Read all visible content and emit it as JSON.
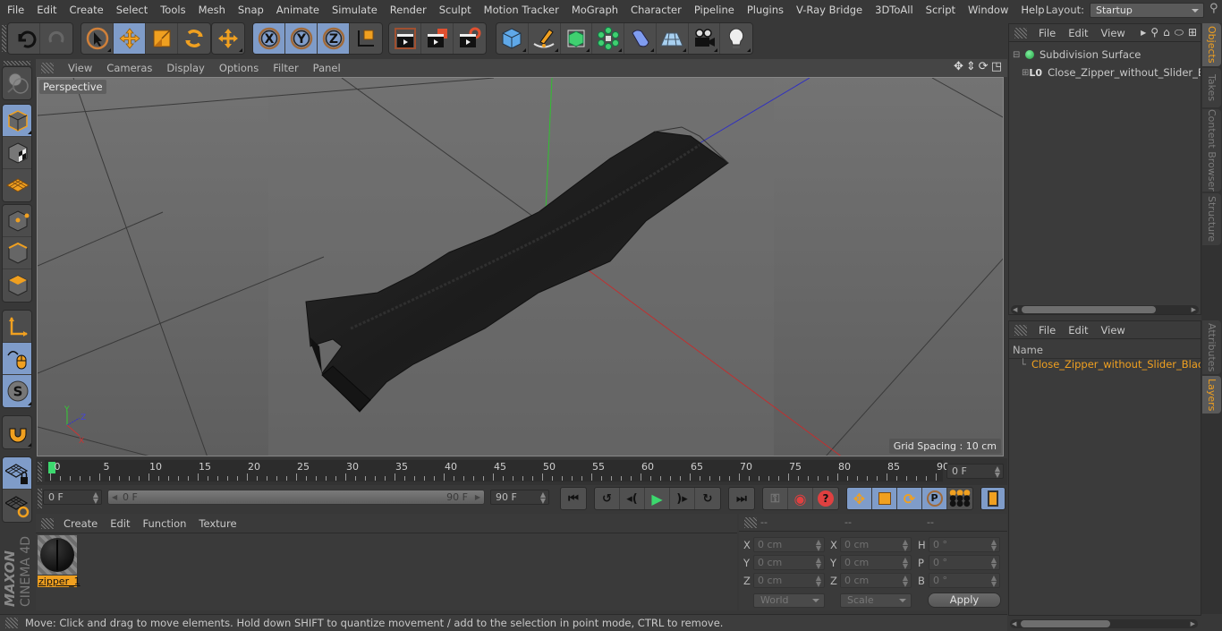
{
  "menubar": {
    "items": [
      "File",
      "Edit",
      "Create",
      "Select",
      "Tools",
      "Mesh",
      "Snap",
      "Animate",
      "Simulate",
      "Render",
      "Sculpt",
      "Motion Tracker",
      "MoGraph",
      "Character",
      "Pipeline",
      "Plugins",
      "V-Ray Bridge",
      "3DToAll",
      "Script",
      "Window",
      "Help"
    ],
    "layout_label": "Layout:",
    "layout_value": "Startup"
  },
  "toolbar": {
    "groups": [
      {
        "buttons": [
          {
            "icon": "undo-icon",
            "active": false
          },
          {
            "icon": "redo-icon",
            "active": false
          }
        ]
      },
      {
        "buttons": [
          {
            "icon": "live-selection-icon",
            "active": false
          },
          {
            "icon": "move-icon",
            "active": true
          },
          {
            "icon": "scale-icon",
            "active": false
          },
          {
            "icon": "rotate-icon",
            "active": false
          }
        ]
      },
      {
        "buttons": [
          {
            "icon": "recent-tools-icon",
            "active": false
          }
        ]
      },
      {
        "buttons": [
          {
            "icon": "x-axis-lock-icon",
            "active": true
          },
          {
            "icon": "y-axis-lock-icon",
            "active": true
          },
          {
            "icon": "z-axis-lock-icon",
            "active": true
          },
          {
            "icon": "coordinate-system-icon",
            "active": false
          }
        ]
      },
      {
        "buttons": [
          {
            "icon": "render-view-icon",
            "active": false
          },
          {
            "icon": "render-to-picture-viewer-icon",
            "active": false
          },
          {
            "icon": "render-settings-icon",
            "active": false
          }
        ]
      },
      {
        "buttons": [
          {
            "icon": "cube-primitive-icon",
            "active": false
          },
          {
            "icon": "pen-spline-icon",
            "active": false
          },
          {
            "icon": "subdivision-surface-icon",
            "active": false
          },
          {
            "icon": "cloner-icon",
            "active": false
          },
          {
            "icon": "deformer-icon",
            "active": false
          },
          {
            "icon": "floor-icon",
            "active": false
          },
          {
            "icon": "camera-icon",
            "active": false
          },
          {
            "icon": "light-icon",
            "active": false
          }
        ]
      }
    ]
  },
  "left_tools": [
    {
      "icon": "make-editable-icon",
      "active": false
    },
    {
      "icon": "model-mode-icon",
      "active": true
    },
    {
      "icon": "texture-mode-icon",
      "active": false
    },
    {
      "icon": "workplane-mode-icon",
      "active": false
    },
    {
      "icon": "points-mode-icon",
      "active": false
    },
    {
      "icon": "edges-mode-icon",
      "active": false
    },
    {
      "icon": "polygons-mode-icon",
      "active": false
    },
    {
      "icon": "axis-mode-icon",
      "active": false
    },
    {
      "icon": "tweak-mode-icon",
      "active": true
    },
    {
      "icon": "solo-mode-icon",
      "active": true
    },
    {
      "icon": "snapping-icon",
      "active": false
    },
    {
      "icon": "lock-workplane-icon",
      "active": true
    },
    {
      "icon": "workplane-align-icon",
      "active": false
    }
  ],
  "viewport": {
    "menu": [
      "View",
      "Cameras",
      "Display",
      "Options",
      "Filter",
      "Panel"
    ],
    "camera_label": "Perspective",
    "grid_spacing": "Grid Spacing : 10 cm",
    "axis_labels": {
      "x": "X",
      "y": "Y",
      "z": "Z"
    },
    "colors": {
      "x_axis": "#cc3333",
      "y_axis": "#33cc33",
      "z_axis": "#3333cc",
      "background": "#6b6b6b"
    }
  },
  "timeline": {
    "ticks": [
      0,
      5,
      10,
      15,
      20,
      25,
      30,
      35,
      40,
      45,
      50,
      55,
      60,
      65,
      70,
      75,
      80,
      85,
      90
    ],
    "max": 90,
    "current_frame": 0,
    "current_frame_field": "0 F",
    "start_field": "0 F",
    "range_start": "0 F",
    "range_end": "90 F",
    "end_field": "90 F",
    "cursor_color": "#3cd86e"
  },
  "playback": {
    "buttons": [
      "go-to-start-icon",
      "previous-key-icon",
      "previous-frame-icon",
      "play-forward-icon",
      "next-frame-icon",
      "next-key-icon",
      "go-to-end-icon",
      "record-active-objects-icon",
      "autokeying-icon",
      "keyframe-selection-icon",
      "record-position-icon",
      "record-scale-icon",
      "record-rotation-icon",
      "record-parameter-icon",
      "record-pla-icon",
      "timeline-icon"
    ]
  },
  "material_manager": {
    "menu": [
      "Create",
      "Edit",
      "Function",
      "Texture"
    ],
    "materials": [
      {
        "name": "zipper_1",
        "selected": true
      }
    ]
  },
  "coordinates": {
    "headers": [
      "--",
      "--",
      "--"
    ],
    "rows": [
      {
        "l1": "X",
        "v1": "0 cm",
        "l2": "X",
        "v2": "0 cm",
        "l3": "H",
        "v3": "0 °"
      },
      {
        "l1": "Y",
        "v1": "0 cm",
        "l2": "Y",
        "v2": "0 cm",
        "l3": "P",
        "v3": "0 °"
      },
      {
        "l1": "Z",
        "v1": "0 cm",
        "l2": "Z",
        "v2": "0 cm",
        "l3": "B",
        "v3": "0 °"
      }
    ],
    "mode_dropdown": "World",
    "size_dropdown": "Scale",
    "apply_label": "Apply"
  },
  "status_bar": {
    "text": "Move: Click and drag to move elements. Hold down SHIFT to quantize movement / add to the selection in point mode, CTRL to remove."
  },
  "object_manager": {
    "menu": [
      "File",
      "Edit",
      "View"
    ],
    "objects": [
      {
        "name": "Subdivision Surface",
        "icon": "subdivision-surface-icon",
        "expanded": true
      },
      {
        "name": "Close_Zipper_without_Slider_Bla",
        "icon": "null-object-icon",
        "expanded": false
      }
    ]
  },
  "layer_manager": {
    "menu": [
      "File",
      "Edit",
      "View"
    ],
    "column_header": "Name",
    "layers": [
      {
        "name": "Close_Zipper_without_Slider_Black",
        "color": "#e6d41e"
      }
    ]
  },
  "side_tabs_top": [
    {
      "label": "Objects",
      "active": true
    },
    {
      "label": "Takes",
      "active": false
    },
    {
      "label": "Content Browser",
      "active": false
    },
    {
      "label": "Structure",
      "active": false
    }
  ],
  "side_tabs_bottom": [
    {
      "label": "Attributes",
      "active": false
    },
    {
      "label": "Layers",
      "active": true
    }
  ],
  "logo": {
    "brand": "MAXON",
    "product": "CINEMA 4D"
  }
}
